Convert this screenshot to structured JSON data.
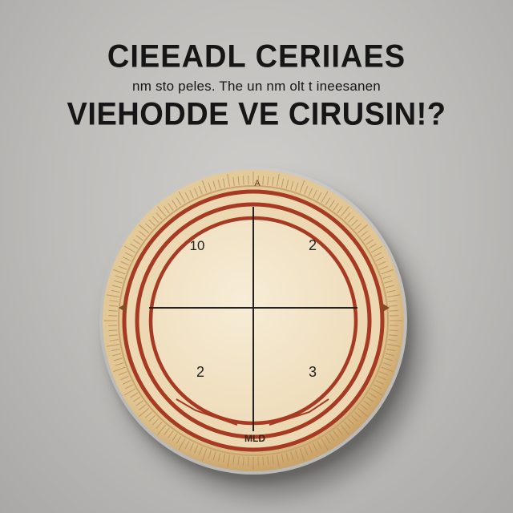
{
  "headline": {
    "line1": "CIEEADL CERIIAES",
    "line2": "nm sto peles. The un nm olt t ineesanen",
    "line3": "VIEHODDE VE CIRUSIN!?"
  },
  "dial": {
    "quadrant_labels": {
      "top_left": "10",
      "top_right": "2",
      "bottom_left": "2",
      "bottom_right": "3"
    },
    "top_marker": "A",
    "bottom_marker": "MLD",
    "colors": {
      "face": "#f3e6cc",
      "rim": "#e2c999",
      "ring_red": "#a63a22",
      "cross_lines": "#222222",
      "background": "#c4c3c0"
    }
  }
}
